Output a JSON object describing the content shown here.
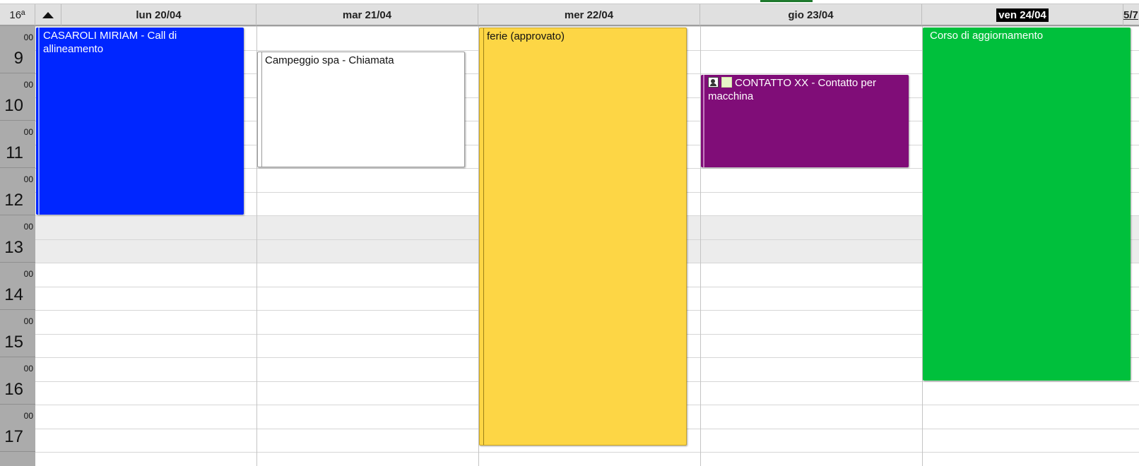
{
  "calendar": {
    "week_label": "16ª",
    "days": [
      {
        "label": "lun 20/04",
        "today": false
      },
      {
        "label": "mar 21/04",
        "today": false
      },
      {
        "label": "mer 22/04",
        "today": false
      },
      {
        "label": "gio 23/04",
        "today": false
      },
      {
        "label": "ven 24/04",
        "today": true
      }
    ],
    "page_indicator": "5/7",
    "hours": [
      {
        "hour": "9",
        "minutes": "00"
      },
      {
        "hour": "10",
        "minutes": "00"
      },
      {
        "hour": "11",
        "minutes": "00"
      },
      {
        "hour": "12",
        "minutes": "00"
      },
      {
        "hour": "13",
        "minutes": "00"
      },
      {
        "hour": "14",
        "minutes": "00"
      },
      {
        "hour": "15",
        "minutes": "00"
      },
      {
        "hour": "16",
        "minutes": "00"
      },
      {
        "hour": "17",
        "minutes": "00"
      }
    ],
    "events": [
      {
        "title": "CASAROLI MIRIAM - Call di allineamento",
        "day": 0,
        "start": "09:00",
        "end": "13:00",
        "color": "#0026ff",
        "style": "blue"
      },
      {
        "title": "Campeggio spa - Chiamata",
        "day": 1,
        "start": "09:30",
        "end": "12:00",
        "color": "#ffffff",
        "style": "white"
      },
      {
        "title": "ferie (approvato)",
        "day": 2,
        "start": "09:00",
        "end": "18:00",
        "color": "#fdd645",
        "style": "yellow"
      },
      {
        "title": "CONTATTO XX - Contatto per macchina",
        "day": 3,
        "start": "10:00",
        "end": "12:00",
        "color": "#800d78",
        "style": "purple",
        "icons": [
          "contact-card-icon",
          "note-icon"
        ]
      },
      {
        "title": "Corso di aggiornamento",
        "day": 4,
        "start": "09:00",
        "end": "16:30",
        "color": "#00c03c",
        "style": "green"
      }
    ],
    "colors": {
      "header_bg": "#e0e0e0",
      "hour_column_bg": "#ababab",
      "lunch_band": "#ececec",
      "today_badge": "#000000"
    }
  }
}
